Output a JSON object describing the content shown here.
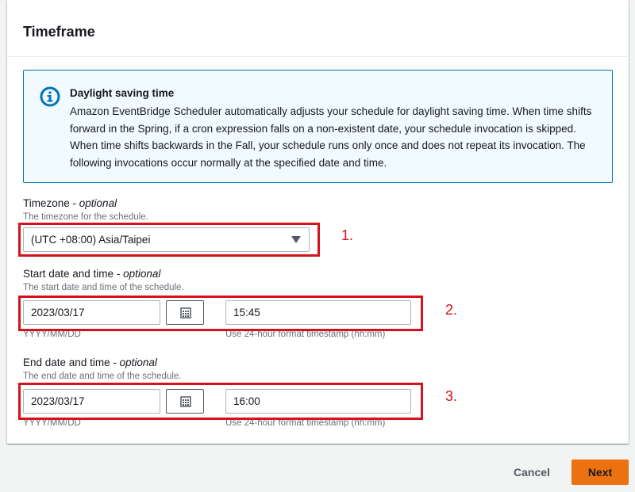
{
  "panel": {
    "title": "Timeframe"
  },
  "info": {
    "icon": "info-icon",
    "title": "Daylight saving time",
    "text": "Amazon EventBridge Scheduler automatically adjusts your schedule for daylight saving time. When time shifts forward in the Spring, if a cron expression falls on a non-existent date, your schedule invocation is skipped. When time shifts backwards in the Fall, your schedule runs only once and does not repeat its invocation. The following invocations occur normally at the specified date and time."
  },
  "timezone": {
    "label": "Timezone - ",
    "optional": "optional",
    "description": "The timezone for the schedule.",
    "value": "(UTC +08:00) Asia/Taipei"
  },
  "start": {
    "label": "Start date and time - ",
    "optional": "optional",
    "description": "The start date and time of the schedule.",
    "date": "2023/03/17",
    "time": "15:45",
    "date_hint": "YYYY/MM/DD",
    "time_hint": "Use 24-hour format timestamp (hh:mm)"
  },
  "end": {
    "label": "End date and time - ",
    "optional": "optional",
    "description": "The end date and time of the schedule.",
    "date": "2023/03/17",
    "time": "16:00",
    "date_hint": "YYYY/MM/DD",
    "time_hint": "Use 24-hour format timestamp (hh:mm)"
  },
  "annotations": {
    "one": "1.",
    "two": "2.",
    "three": "3."
  },
  "footer": {
    "cancel": "Cancel",
    "next": "Next"
  },
  "colors": {
    "accent": "#ec7211",
    "info_border": "#0073bb",
    "info_bg": "#f1faff",
    "annotation_red": "#d6121c"
  }
}
